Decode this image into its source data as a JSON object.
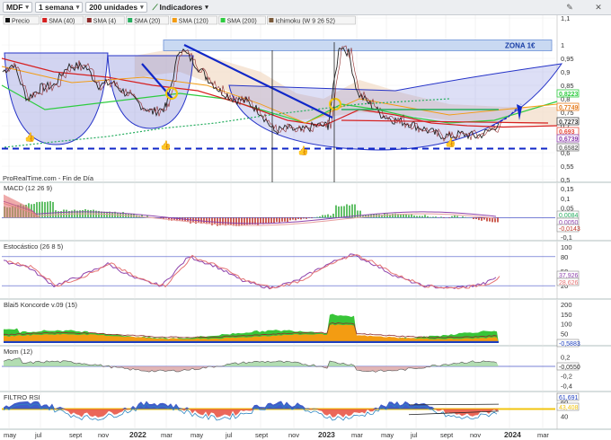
{
  "toolbar": {
    "symbol": "MDF",
    "period": "1 semana",
    "units": "200 unidades",
    "indicators_label": "Indicadores"
  },
  "price_panel": {
    "legend": [
      "Precio",
      "SMA (40)",
      "SMA (4)",
      "SMA (20)",
      "SMA (120)",
      "SMA (200)",
      "Ichimoku (W 9 26 52)"
    ],
    "zone_label": "ZONA 1€",
    "footer": "ProRealTime.com - Fin de Día",
    "axis_ticks": [
      "1,1",
      "1",
      "0,95",
      "0,9",
      "0,85",
      "0,8",
      "0,75",
      "0,7",
      "0,65",
      "0,6",
      "0,55",
      "0,5"
    ],
    "price_tags": [
      {
        "text": "0,8223",
        "color": "#2ecc40"
      },
      {
        "text": "0,7749",
        "color": "#e67e22"
      },
      {
        "text": "0,7273",
        "color": "#444444"
      },
      {
        "text": "0,693",
        "color": "#e74c3c"
      },
      {
        "text": "0,6739",
        "color": "#8e44ad"
      },
      {
        "text": "0,6582",
        "color": "#777777"
      }
    ]
  },
  "macd_panel": {
    "title": "MACD (12 26 9)",
    "ticks": [
      "0,15",
      "0,1",
      "0,05",
      "0",
      "-0,05",
      "-0,1"
    ],
    "tags": [
      "0,0084",
      "0,0050",
      "-0,0143"
    ]
  },
  "stoch_panel": {
    "title": "Estocástico (26 8 5)",
    "ticks": [
      "100",
      "80",
      "50",
      "20"
    ],
    "tags": [
      "37,926",
      "28,626"
    ]
  },
  "blai_panel": {
    "title": "Blai5 Koncorde v.09 (15)",
    "ticks": [
      "200",
      "150",
      "100",
      "50",
      "0"
    ],
    "tags": [
      "-0,5883"
    ]
  },
  "mom_panel": {
    "title": "Mom (12)",
    "ticks": [
      "0,2",
      "-0,2",
      "-0,4"
    ],
    "tags": [
      "-0,0550"
    ]
  },
  "rsi_panel": {
    "title": "FILTRO RSI",
    "ticks": [
      "60",
      "40"
    ],
    "tags": [
      "61,691",
      "43,408"
    ]
  },
  "time_axis": [
    "may",
    "jul",
    "sept",
    "nov",
    "2022",
    "mar",
    "may",
    "jul",
    "sept",
    "nov",
    "2023",
    "mar",
    "may",
    "jul",
    "sept",
    "nov",
    "2024",
    "mar"
  ],
  "chart_data": {
    "type": "line",
    "title": "MDF",
    "x": [
      "may",
      "jul",
      "sept",
      "nov",
      "2022",
      "mar",
      "may",
      "jul",
      "sept",
      "nov",
      "2023",
      "mar",
      "may",
      "jul",
      "sept",
      "nov",
      "2024"
    ],
    "series": [
      {
        "name": "Precio",
        "values": [
          0.93,
          0.83,
          0.86,
          0.9,
          0.93,
          0.78,
          0.98,
          0.83,
          0.72,
          0.67,
          0.71,
          0.95,
          0.78,
          0.71,
          0.66,
          0.67,
          0.71
        ]
      },
      {
        "name": "SMA (40)",
        "values": [
          0.95,
          0.92,
          0.9,
          0.88,
          0.87,
          0.86,
          0.85,
          0.84,
          0.82,
          0.8,
          0.78,
          0.77,
          0.76,
          0.75,
          0.73,
          0.71,
          0.69
        ]
      }
    ],
    "ylim": [
      0.5,
      1.1
    ],
    "annotations": [
      "ZONA 1€"
    ]
  }
}
